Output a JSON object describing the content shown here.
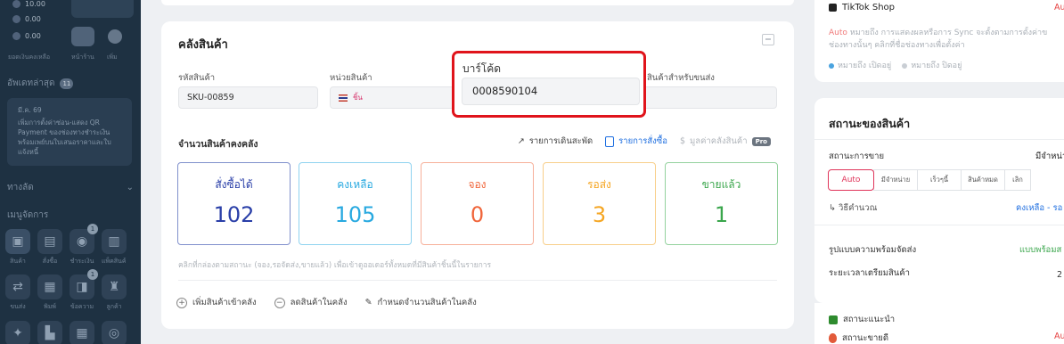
{
  "sidebar": {
    "stats": [
      "10.00",
      "0.00",
      "0.00"
    ],
    "mini_labels": [
      "ยอดเงินคงเหลือ",
      "หน้าร้าน",
      "เพิ่ม"
    ],
    "recent_label": "อัพเดทล่าสุด",
    "recent_count": "11",
    "notice": {
      "date": "มี.ค. 69",
      "text": "เพิ่มการตั้งค่าซ่อน-แสดง QR Payment ของช่องทางชำระเงินพร้อมเพย์บนใบเสนอราคาและใบแจ้งหนี้"
    },
    "shortcuts_label": "ทางลัด",
    "menu_label": "เมนูจัดการ",
    "row1_labels": [
      "สินค้า",
      "สั่งซื้อ",
      "ชำระเงิน",
      "แพ็คสินค้า"
    ],
    "row1_badges": [
      "",
      "",
      "1",
      ""
    ],
    "row2_labels": [
      "ขนส่ง",
      "พิมพ์",
      "ข้อความ",
      "ลูกค้า"
    ],
    "row2_badges": [
      "",
      "",
      "1",
      ""
    ]
  },
  "warehouse": {
    "title": "คลังสินค้า",
    "sku_label": "รหัสสินค้า",
    "sku_value": "SKU-00859",
    "unit_label": "หน่วยสินค้า",
    "unit_value": "ชิ้น",
    "barcode_label": "บาร์โค้ด",
    "barcode_value": "0008590104",
    "shipping_label": "สินค้าสำหรับขนส่ง",
    "shipping_value": "",
    "qty_title": "จำนวนสินค้าคงคลัง",
    "actions": {
      "movement": "รายการเดินสะพัด",
      "orders": "รายการสั่งซื้อ",
      "stock_value": "มูลค่าคลังสินค้า",
      "pro": "Pro"
    },
    "stats": [
      {
        "label": "สั่งซื้อได้",
        "value": "102",
        "color": "#2a3fa8",
        "border": "#8090cc"
      },
      {
        "label": "คงเหลือ",
        "value": "105",
        "color": "#28a9e0",
        "border": "#8fd3f0"
      },
      {
        "label": "จอง",
        "value": "0",
        "color": "#f0653a",
        "border": "#f7b09a"
      },
      {
        "label": "รอส่ง",
        "value": "3",
        "color": "#f5a623",
        "border": "#f8cf8a"
      },
      {
        "label": "ขายแล้ว",
        "value": "1",
        "color": "#3aa64c",
        "border": "#94d29e"
      }
    ],
    "hint": "คลิกที่กล่องตามสถานะ (จอง,รอจัดส่ง,ขายแล้ว) เพื่อเข้าดูออเดอร์ทั้งหมดที่มีสินค้าชิ้นนี้ในรายการ",
    "add_stock": "เพิ่มสินค้าเข้าคลัง",
    "remove_stock": "ลดสินค้าในคลัง",
    "set_stock": "กำหนดจำนวนสินค้าในคลัง"
  },
  "right_panel": {
    "tiktok_label": "TikTok Shop",
    "tiktok_status": "Auto",
    "desc_auto": "Auto",
    "desc_line1": " หมายถึง การแสดงผลหรือการ Sync จะตั้งตามการตั้งค่าข",
    "desc_line2": "ช่องทางนั้นๆ คลิกที่ชื่อช่องทางเพื่อตั้งค่า",
    "legend_on": "หมายถึง เปิดอยู่",
    "legend_off": "หมายถึง ปิดอยู่",
    "legend_on_color": "#4aa3df",
    "legend_off_color": "#c9ced4",
    "status_title": "สถานะของสินค้า",
    "sell_status_label": "สถานะการขาย",
    "sell_status_value": "มีจำหน่าย",
    "segments": [
      "Auto",
      "มีจำหน่าย",
      "เร็วๆนี้",
      "สินค้าหมด",
      "เลิก"
    ],
    "calc_label": "วิธีคำนวณ",
    "calc_value": "คงเหลือ - รอ",
    "ready_label": "รูปแบบความพร้อมจัดส่ง",
    "ready_value": "แบบพร้อมส",
    "prep_label": "ระยะเวลาเตรียมสินค้า",
    "prep_value": "2",
    "recommend_label": "สถานะแนะนำ",
    "bestseller_label": "สถานะขายดี",
    "bestseller_value": "Au"
  }
}
